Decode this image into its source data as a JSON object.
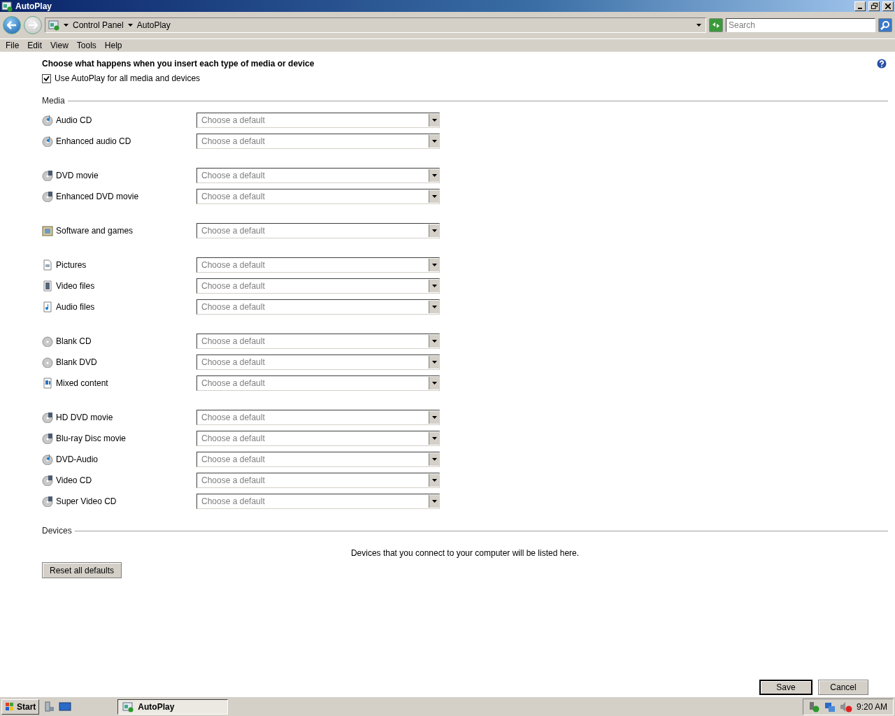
{
  "window": {
    "title": "AutoPlay"
  },
  "address_bar": {
    "breadcrumbs": [
      "Control Panel",
      "AutoPlay"
    ],
    "search": {
      "placeholder": "Search"
    }
  },
  "menu_bar": [
    "File",
    "Edit",
    "View",
    "Tools",
    "Help"
  ],
  "heading": "Choose what happens when you insert each type of media or device",
  "use_autoplay": {
    "label": "Use AutoPlay for all media and devices",
    "checked": true
  },
  "media": {
    "title": "Media",
    "groups": [
      [
        {
          "label": "Audio CD",
          "kind": "audio-disc",
          "value": "Choose a default"
        },
        {
          "label": "Enhanced audio CD",
          "kind": "audio-disc",
          "value": "Choose a default"
        }
      ],
      [
        {
          "label": "DVD movie",
          "kind": "video-disc",
          "value": "Choose a default"
        },
        {
          "label": "Enhanced DVD movie",
          "kind": "video-disc",
          "value": "Choose a default"
        }
      ],
      [
        {
          "label": "Software and games",
          "kind": "software",
          "value": "Choose a default"
        }
      ],
      [
        {
          "label": "Pictures",
          "kind": "picture-file",
          "value": "Choose a default"
        },
        {
          "label": "Video files",
          "kind": "video-file",
          "value": "Choose a default"
        },
        {
          "label": "Audio files",
          "kind": "audio-file",
          "value": "Choose a default"
        }
      ],
      [
        {
          "label": "Blank CD",
          "kind": "blank-disc",
          "value": "Choose a default"
        },
        {
          "label": "Blank DVD",
          "kind": "blank-disc",
          "value": "Choose a default"
        },
        {
          "label": "Mixed content",
          "kind": "mixed",
          "value": "Choose a default"
        }
      ],
      [
        {
          "label": "HD DVD movie",
          "kind": "video-disc",
          "value": "Choose a default"
        },
        {
          "label": "Blu-ray Disc movie",
          "kind": "video-disc",
          "value": "Choose a default"
        },
        {
          "label": "DVD-Audio",
          "kind": "audio-disc",
          "value": "Choose a default"
        },
        {
          "label": "Video CD",
          "kind": "video-disc",
          "value": "Choose a default"
        },
        {
          "label": "Super Video CD",
          "kind": "video-disc",
          "value": "Choose a default"
        }
      ]
    ]
  },
  "devices": {
    "title": "Devices",
    "message": "Devices that you connect to your computer will be listed here."
  },
  "reset_button": "Reset all defaults",
  "buttons": [
    "Save",
    "Cancel"
  ],
  "taskbar": {
    "start": "Start",
    "tasks": [
      {
        "label": "AutoPlay",
        "selected": true
      }
    ],
    "clock": "9:20 AM"
  }
}
